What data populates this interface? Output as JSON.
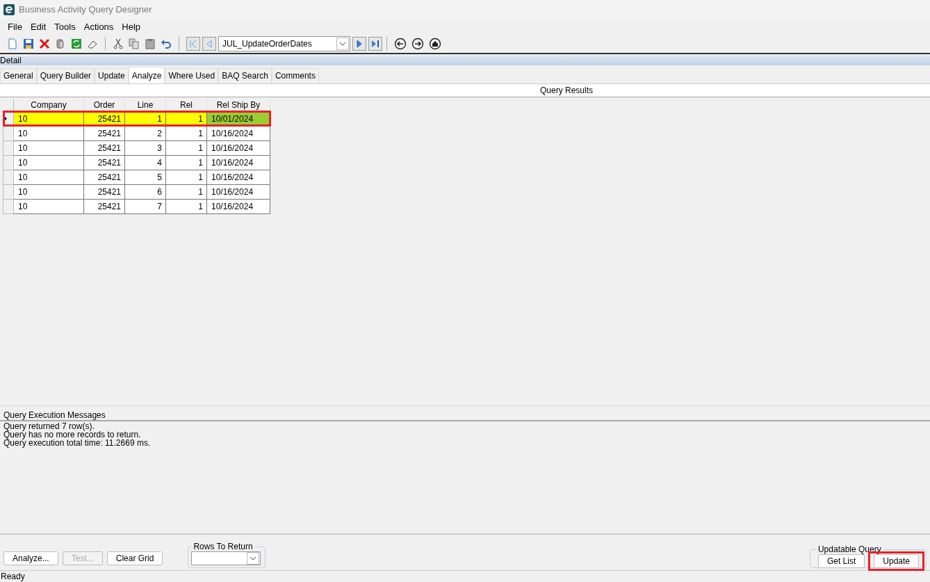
{
  "window": {
    "title": "Business Activity Query Designer"
  },
  "menu": [
    "File",
    "Edit",
    "Tools",
    "Actions",
    "Help"
  ],
  "toolbar": {
    "query_id": "JUL_UpdateOrderDates"
  },
  "panel": {
    "title": "Detail"
  },
  "tabs": [
    {
      "label": "General",
      "selected": false
    },
    {
      "label": "Query Builder",
      "selected": false
    },
    {
      "label": "Update",
      "selected": false
    },
    {
      "label": "Analyze",
      "selected": true
    },
    {
      "label": "Where Used",
      "selected": false
    },
    {
      "label": "BAQ Search",
      "selected": false
    },
    {
      "label": "Comments",
      "selected": false
    }
  ],
  "results": {
    "title": "Query Results",
    "columns": [
      "Company",
      "Order",
      "Line",
      "Rel",
      "Rel Ship By"
    ],
    "rows": [
      {
        "company": "10",
        "order": "25421",
        "line": "1",
        "rel": "1",
        "ship_by": "10/01/2024",
        "selected": true,
        "ship_by_changed": true,
        "callout": true
      },
      {
        "company": "10",
        "order": "25421",
        "line": "2",
        "rel": "1",
        "ship_by": "10/16/2024",
        "selected": false,
        "ship_by_changed": false,
        "callout": false
      },
      {
        "company": "10",
        "order": "25421",
        "line": "3",
        "rel": "1",
        "ship_by": "10/16/2024",
        "selected": false,
        "ship_by_changed": false,
        "callout": false
      },
      {
        "company": "10",
        "order": "25421",
        "line": "4",
        "rel": "1",
        "ship_by": "10/16/2024",
        "selected": false,
        "ship_by_changed": false,
        "callout": false
      },
      {
        "company": "10",
        "order": "25421",
        "line": "5",
        "rel": "1",
        "ship_by": "10/16/2024",
        "selected": false,
        "ship_by_changed": false,
        "callout": false
      },
      {
        "company": "10",
        "order": "25421",
        "line": "6",
        "rel": "1",
        "ship_by": "10/16/2024",
        "selected": false,
        "ship_by_changed": false,
        "callout": false
      },
      {
        "company": "10",
        "order": "25421",
        "line": "7",
        "rel": "1",
        "ship_by": "10/16/2024",
        "selected": false,
        "ship_by_changed": false,
        "callout": false
      }
    ]
  },
  "messages": {
    "title": "Query Execution Messages",
    "lines": [
      "Query returned 7 row(s).",
      "Query has no more records to return.",
      "Query execution total time: 11.2669 ms."
    ]
  },
  "actions": [
    {
      "label": "Analyze...",
      "disabled": false
    },
    {
      "label": "Test...",
      "disabled": true
    },
    {
      "label": "Clear Grid",
      "disabled": false
    }
  ],
  "rows_to_return": {
    "label": "Rows To Return"
  },
  "updatable_query": {
    "label": "Updatable Query",
    "buttons": [
      {
        "label": "Get List",
        "callout": false
      },
      {
        "label": "Update",
        "callout": true
      }
    ]
  },
  "status_bar": "Ready"
}
